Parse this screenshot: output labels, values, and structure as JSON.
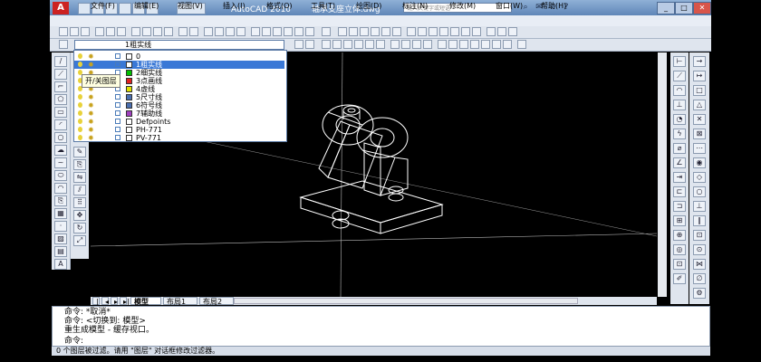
{
  "title_bar": {
    "app_name": "AutoCAD 2010",
    "file_name": "轴承支座立体.dwg",
    "search_placeholder": "键入关键字或短语"
  },
  "menu": [
    "文件(F)",
    "编辑(E)",
    "视图(V)",
    "插入(I)",
    "格式(O)",
    "工具(T)",
    "绘图(D)",
    "标注(N)",
    "修改(M)",
    "窗口(W)",
    "帮助(H)"
  ],
  "layer_combo": {
    "current": "1粗实线"
  },
  "layers": [
    {
      "name": "0",
      "color": "#ffffff"
    },
    {
      "name": "1粗实线",
      "color": "#ffffff",
      "selected": true
    },
    {
      "name": "2细实线",
      "color": "#00c000"
    },
    {
      "name": "3点画线",
      "color": "#e02020"
    },
    {
      "name": "4虚线",
      "color": "#e0e000"
    },
    {
      "name": "5尺寸线",
      "color": "#4a6fb0"
    },
    {
      "name": "6符号线",
      "color": "#4a6fb0"
    },
    {
      "name": "7辅助线",
      "color": "#a040c0"
    },
    {
      "name": "Defpoints",
      "color": "#ffffff"
    },
    {
      "name": "PH-771",
      "color": "#ffffff"
    },
    {
      "name": "PV-771",
      "color": "#ffffff"
    }
  ],
  "tooltip": "开/关图层",
  "tabs": [
    "模型",
    "布局1",
    "布局2"
  ],
  "command_lines": [
    "命令: *取消*",
    "命令:  <切换到: 模型>",
    "重生成模型 - 缓存视口。"
  ],
  "command_prompt": "命令:",
  "status_text": "0 个图层被过滤。请用 \"图层\" 对话框修改过滤器。",
  "colors": {
    "titlebar": "#6d91c0",
    "canvas": "#000000",
    "selection": "#3a78d6"
  }
}
